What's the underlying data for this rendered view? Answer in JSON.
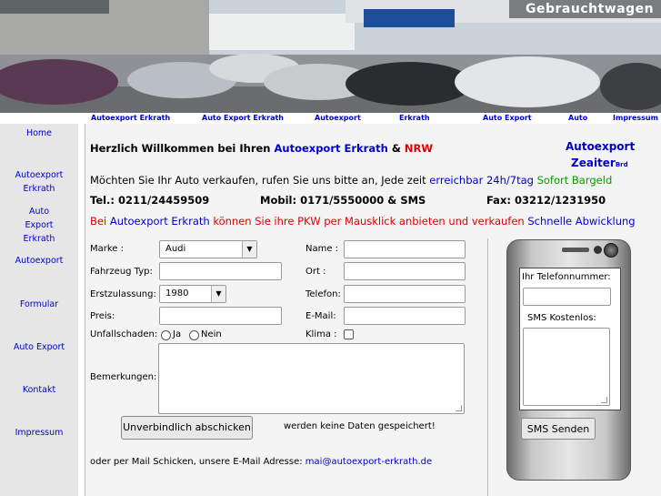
{
  "banner": {
    "sign_text": "Gebrauchtwagen"
  },
  "topnav": [
    "Autoexport Erkrath",
    "Auto Export Erkrath",
    "Autoexport",
    "Erkrath",
    "Auto Export",
    "Auto",
    "Impressum"
  ],
  "sidebar": [
    "Home",
    "Autoexport Erkrath",
    "Auto Export Erkrath",
    "Autoexport",
    "Formular",
    "Auto Export",
    "Kontakt",
    "Impressum"
  ],
  "brand": {
    "line1": "Autoexport",
    "line2": "Zeaiter",
    "line2_suffix": "Brd"
  },
  "welcome": {
    "prefix": "Herzlich Willkommen bei Ihren ",
    "name": "Autoexport Erkrath",
    "amp": " & ",
    "region": "NRW"
  },
  "intro": {
    "text": "Möchten Sie Ihr Auto verkaufen, rufen Sie uns bitte an, Jede zeit ",
    "reach": "erreichbar 24h/7tag",
    "cash": "Sofort Bargeld"
  },
  "contact": {
    "tel": "Tel.: 0211/24459509",
    "mobil": "Mobil: 0171/5550000 & SMS",
    "fax": "Fax: 03212/1231950"
  },
  "offer": {
    "a": "Bei ",
    "b": "Autoexport Erkrath",
    "c": " können Sie ihre PKW per Mausklick anbieten und verkaufen ",
    "d": "Schnelle Abwicklung"
  },
  "form": {
    "marke_label": "Marke :",
    "marke_value": "Audi",
    "typ_label": "Fahrzeug Typ:",
    "erst_label": "Erstzulassung:",
    "erst_value": "1980",
    "preis_label": "Preis:",
    "unfall_label": "Unfallschaden:",
    "ja": "Ja",
    "nein": "Nein",
    "bemerk_label": "Bemerkungen:",
    "name_label": "Name :",
    "ort_label": "Ort :",
    "tel_label": "Telefon:",
    "email_label": "E-Mail:",
    "klima_label": "Klima :",
    "submit": "Unverbindlich abschicken",
    "note": "werden keine Daten gespeichert!"
  },
  "mail": {
    "text": "oder per Mail Schicken, unsere E-Mail Adresse: ",
    "address": "mai@autoexport-erkrath.de"
  },
  "phone": {
    "tel_label": "Ihr Telefonnummer:",
    "sms_label": "SMS Kostenlos:",
    "send": "SMS Senden"
  },
  "colors": {
    "link": "#0000cc",
    "red": "#e00000",
    "green": "#00a000",
    "sidebar_bg": "#e6e6e6",
    "main_bg": "#f4f4f4"
  }
}
